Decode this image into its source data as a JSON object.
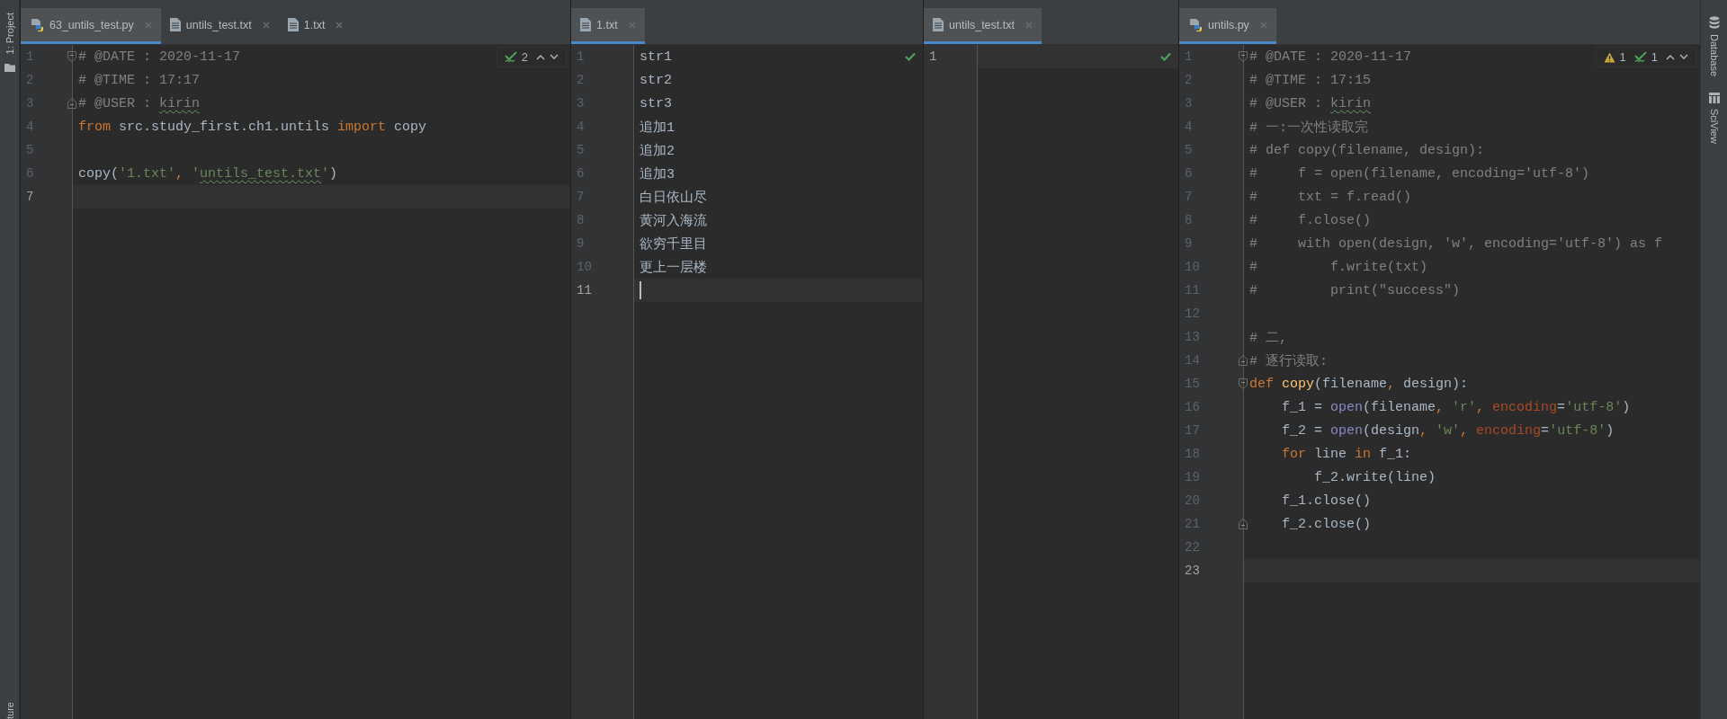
{
  "left_strip": [
    {
      "label": "1: Project",
      "kind": "project"
    },
    {
      "label": "ture",
      "kind": "structure"
    }
  ],
  "panes": [
    {
      "tabs": [
        {
          "label": "63_untils_test.py",
          "kind": "python",
          "selected": true
        },
        {
          "label": "untils_test.txt",
          "kind": "text",
          "selected": false
        },
        {
          "label": "1.txt",
          "kind": "text",
          "selected": false
        }
      ],
      "inspection": {
        "kind": "widget",
        "passed": "2"
      },
      "lines": [
        {
          "number": "1",
          "fold_start": true,
          "current": false,
          "tokens": [
            {
              "text": "# @DATE : 2020-11-17",
              "kind": "comment"
            }
          ]
        },
        {
          "number": "2",
          "current": false,
          "tokens": [
            {
              "text": "# @TIME : 17:17",
              "kind": "comment"
            }
          ]
        },
        {
          "number": "3",
          "fold_end": true,
          "current": false,
          "tokens": [
            {
              "text": "# @USER : ",
              "kind": "comment"
            },
            {
              "text": "kirin",
              "kind": "comment",
              "typo": true
            }
          ]
        },
        {
          "number": "4",
          "current": false,
          "tokens": [
            {
              "text": "from",
              "kind": "keyword"
            },
            {
              "text": " src.study_first.ch1.untils ",
              "kind": "plain"
            },
            {
              "text": "import",
              "kind": "keyword"
            },
            {
              "text": " copy",
              "kind": "plain"
            }
          ]
        },
        {
          "number": "5",
          "current": false
        },
        {
          "number": "6",
          "current": false,
          "tokens": [
            {
              "text": "copy(",
              "kind": "plain"
            },
            {
              "text": "'1.txt'",
              "kind": "string"
            },
            {
              "text": ", ",
              "kind": "keyword"
            },
            {
              "text": "'",
              "kind": "string"
            },
            {
              "text": "untils_test.txt",
              "kind": "string",
              "typo": true
            },
            {
              "text": "'",
              "kind": "string"
            },
            {
              "text": ")",
              "kind": "plain"
            }
          ]
        },
        {
          "number": "7",
          "current": true
        }
      ]
    },
    {
      "tabs": [
        {
          "label": "1.txt",
          "kind": "text",
          "selected": true
        }
      ],
      "inspection": {
        "kind": "check"
      },
      "lines": [
        {
          "number": "1",
          "current": false,
          "tokens": [
            {
              "text": "str1",
              "kind": "plain"
            }
          ]
        },
        {
          "number": "2",
          "current": false,
          "tokens": [
            {
              "text": "str2",
              "kind": "plain"
            }
          ]
        },
        {
          "number": "3",
          "current": false,
          "tokens": [
            {
              "text": "str3",
              "kind": "plain"
            }
          ]
        },
        {
          "number": "4",
          "current": false,
          "tokens": [
            {
              "text": "追加1",
              "kind": "plain"
            }
          ]
        },
        {
          "number": "5",
          "current": false,
          "tokens": [
            {
              "text": "追加2",
              "kind": "plain"
            }
          ]
        },
        {
          "number": "6",
          "current": false,
          "tokens": [
            {
              "text": "追加3",
              "kind": "plain"
            }
          ]
        },
        {
          "number": "7",
          "current": false,
          "tokens": [
            {
              "text": "白日依山尽",
              "kind": "plain"
            }
          ]
        },
        {
          "number": "8",
          "current": false,
          "tokens": [
            {
              "text": "黄河入海流",
              "kind": "plain"
            }
          ]
        },
        {
          "number": "9",
          "current": false,
          "tokens": [
            {
              "text": "欲穷千里目",
              "kind": "plain"
            }
          ]
        },
        {
          "number": "10",
          "current": false,
          "tokens": [
            {
              "text": "更上一层楼",
              "kind": "plain"
            }
          ]
        },
        {
          "number": "11",
          "current": true,
          "caret": true
        }
      ]
    },
    {
      "tabs": [
        {
          "label": "untils_test.txt",
          "kind": "text",
          "selected": true
        }
      ],
      "inspection": {
        "kind": "check"
      },
      "lines": [
        {
          "number": "1",
          "current": true
        }
      ]
    },
    {
      "tabs": [
        {
          "label": "untils.py",
          "kind": "python",
          "selected": true
        }
      ],
      "inspection": {
        "kind": "widget",
        "warnings": "1",
        "passed": "1"
      },
      "lines": [
        {
          "number": "1",
          "fold_start": true,
          "current": false,
          "tokens": [
            {
              "text": "# @DATE : 2020-11-17",
              "kind": "comment"
            }
          ]
        },
        {
          "number": "2",
          "current": false,
          "tokens": [
            {
              "text": "# @TIME : 17:15",
              "kind": "comment"
            }
          ]
        },
        {
          "number": "3",
          "current": false,
          "tokens": [
            {
              "text": "# @USER : ",
              "kind": "comment"
            },
            {
              "text": "kirin",
              "kind": "comment",
              "typo": true
            }
          ]
        },
        {
          "number": "4",
          "current": false,
          "tokens": [
            {
              "text": "# 一:一次性读取完",
              "kind": "comment"
            }
          ]
        },
        {
          "number": "5",
          "current": false,
          "tokens": [
            {
              "text": "# def copy(filename, design):",
              "kind": "comment"
            }
          ]
        },
        {
          "number": "6",
          "current": false,
          "tokens": [
            {
              "text": "#     f = open(filename, encoding='utf-8')",
              "kind": "comment"
            }
          ]
        },
        {
          "number": "7",
          "current": false,
          "tokens": [
            {
              "text": "#     txt = f.read()",
              "kind": "comment"
            }
          ]
        },
        {
          "number": "8",
          "current": false,
          "tokens": [
            {
              "text": "#     f.close()",
              "kind": "comment"
            }
          ]
        },
        {
          "number": "9",
          "current": false,
          "tokens": [
            {
              "text": "#     with open(design, 'w', encoding='utf-8') as f",
              "kind": "comment"
            }
          ]
        },
        {
          "number": "10",
          "current": false,
          "tokens": [
            {
              "text": "#         f.write(txt)",
              "kind": "comment"
            }
          ]
        },
        {
          "number": "11",
          "current": false,
          "tokens": [
            {
              "text": "#         print(\"success\")",
              "kind": "comment"
            }
          ]
        },
        {
          "number": "12",
          "current": false
        },
        {
          "number": "13",
          "current": false,
          "tokens": [
            {
              "text": "# 二,",
              "kind": "comment"
            }
          ]
        },
        {
          "number": "14",
          "fold_end": true,
          "current": false,
          "tokens": [
            {
              "text": "# 逐行读取:",
              "kind": "comment"
            }
          ]
        },
        {
          "number": "15",
          "fold_start": true,
          "current": false,
          "tokens": [
            {
              "text": "def",
              "kind": "keyword"
            },
            {
              "text": " copy",
              "kind": "function"
            },
            {
              "text": "(filename",
              "kind": "plain"
            },
            {
              "text": ", ",
              "kind": "keyword"
            },
            {
              "text": "design):",
              "kind": "plain"
            }
          ]
        },
        {
          "number": "16",
          "current": false,
          "tokens": [
            {
              "text": "    f_1 = ",
              "kind": "plain"
            },
            {
              "text": "open",
              "kind": "builtin"
            },
            {
              "text": "(filename",
              "kind": "plain"
            },
            {
              "text": ", ",
              "kind": "keyword"
            },
            {
              "text": "'r'",
              "kind": "string"
            },
            {
              "text": ", ",
              "kind": "keyword"
            },
            {
              "text": "encoding",
              "kind": "named"
            },
            {
              "text": "=",
              "kind": "plain"
            },
            {
              "text": "'utf-8'",
              "kind": "string"
            },
            {
              "text": ")",
              "kind": "plain"
            }
          ]
        },
        {
          "number": "17",
          "current": false,
          "tokens": [
            {
              "text": "    f_2 = ",
              "kind": "plain"
            },
            {
              "text": "open",
              "kind": "builtin"
            },
            {
              "text": "(design",
              "kind": "plain"
            },
            {
              "text": ", ",
              "kind": "keyword"
            },
            {
              "text": "'w'",
              "kind": "string"
            },
            {
              "text": ", ",
              "kind": "keyword"
            },
            {
              "text": "encoding",
              "kind": "named"
            },
            {
              "text": "=",
              "kind": "plain"
            },
            {
              "text": "'utf-8'",
              "kind": "string"
            },
            {
              "text": ")",
              "kind": "plain"
            }
          ]
        },
        {
          "number": "18",
          "current": false,
          "tokens": [
            {
              "text": "    for",
              "kind": "keyword"
            },
            {
              "text": " line ",
              "kind": "plain"
            },
            {
              "text": "in",
              "kind": "keyword"
            },
            {
              "text": " f_1:",
              "kind": "plain"
            }
          ]
        },
        {
          "number": "19",
          "current": false,
          "tokens": [
            {
              "text": "        f_2.write(line)",
              "kind": "plain"
            }
          ]
        },
        {
          "number": "20",
          "current": false,
          "tokens": [
            {
              "text": "    f_1.close()",
              "kind": "plain"
            }
          ]
        },
        {
          "number": "21",
          "fold_end": true,
          "current": false,
          "tokens": [
            {
              "text": "    f_2.close()",
              "kind": "plain"
            }
          ]
        },
        {
          "number": "22",
          "current": false
        },
        {
          "number": "23",
          "current": true
        }
      ]
    }
  ],
  "right_strip": [
    {
      "label": "Database",
      "kind": "database"
    },
    {
      "label": "SciView",
      "kind": "sciview"
    }
  ]
}
